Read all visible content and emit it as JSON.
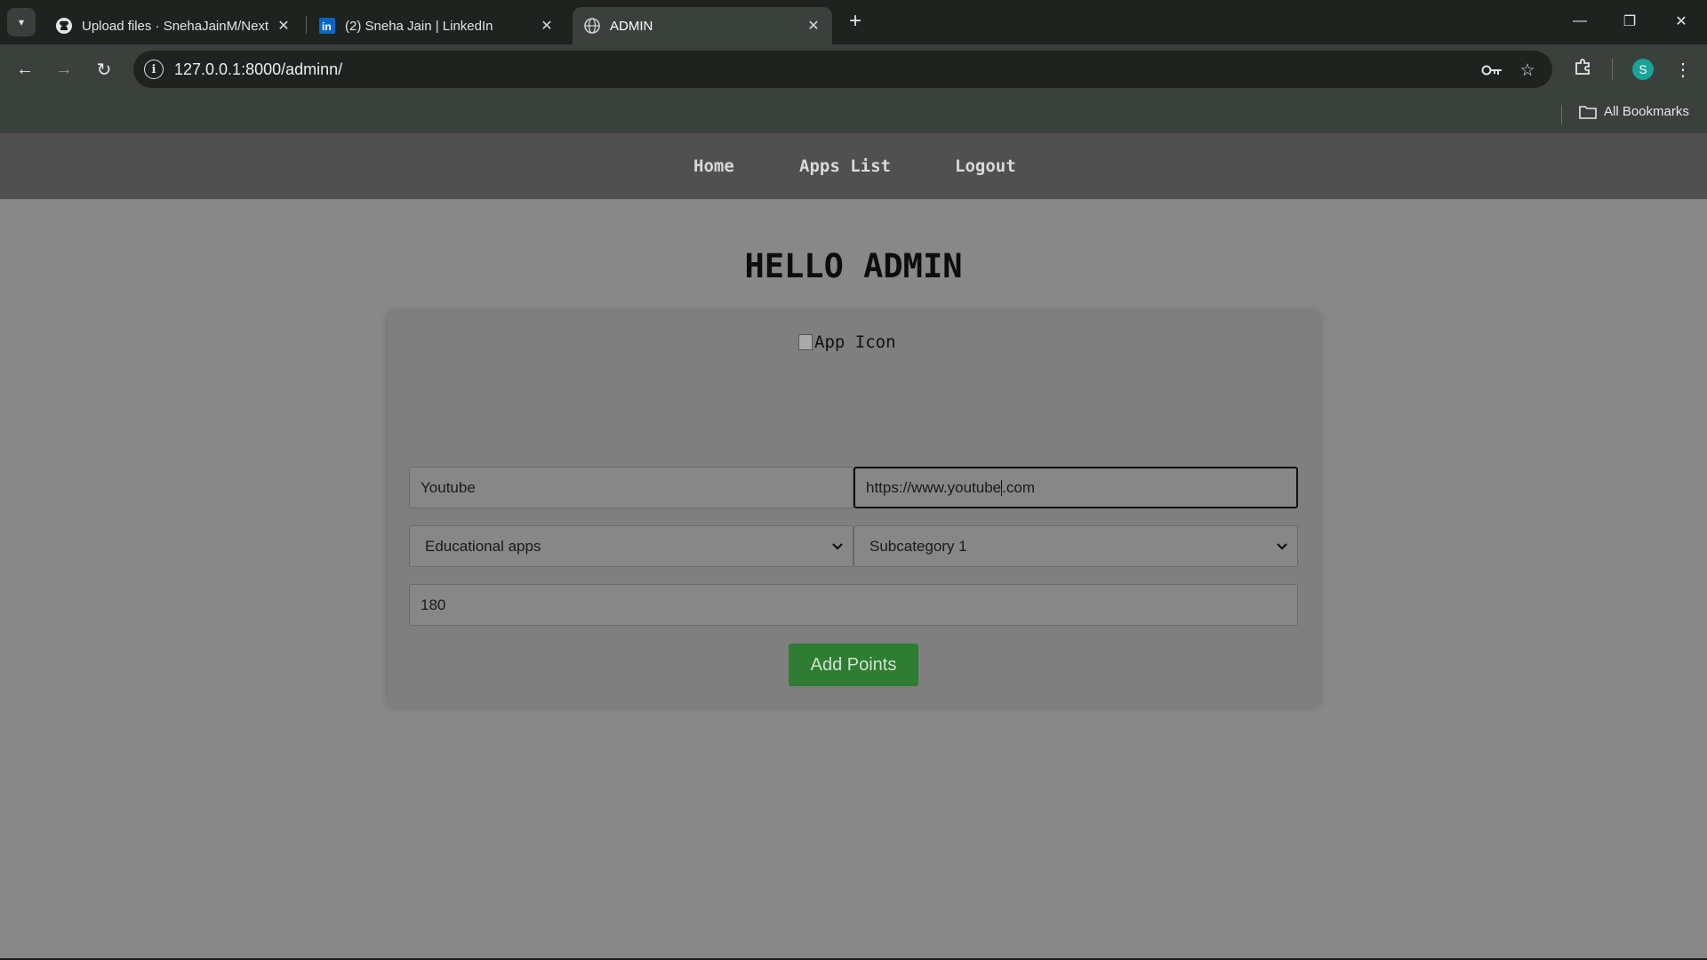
{
  "browser": {
    "tabs": [
      {
        "title": "Upload files · SnehaJainM/Next",
        "favicon": "github-icon"
      },
      {
        "title": "(2) Sneha Jain | LinkedIn",
        "favicon": "linkedin-icon"
      },
      {
        "title": "ADMIN",
        "favicon": "globe-icon"
      }
    ],
    "url": "127.0.0.1:8000/adminn/",
    "profile_initial": "S",
    "bookmarks_label": "All Bookmarks"
  },
  "nav": {
    "home": "Home",
    "apps_list": "Apps List",
    "logout": "Logout"
  },
  "page": {
    "heading": "HELLO ADMIN",
    "app_icon_alt": "App Icon"
  },
  "form": {
    "app_name": "Youtube",
    "app_url_before_caret": "https://www.youtube",
    "app_url_after_caret": ".com",
    "category": "Educational apps",
    "subcategory": "Subcategory 1",
    "points": "180",
    "submit_label": "Add Points"
  },
  "colors": {
    "page_bg": "#888888",
    "nav_bg": "#505050",
    "button_bg": "#2e7d32",
    "browser_chrome": "#3a403b"
  }
}
